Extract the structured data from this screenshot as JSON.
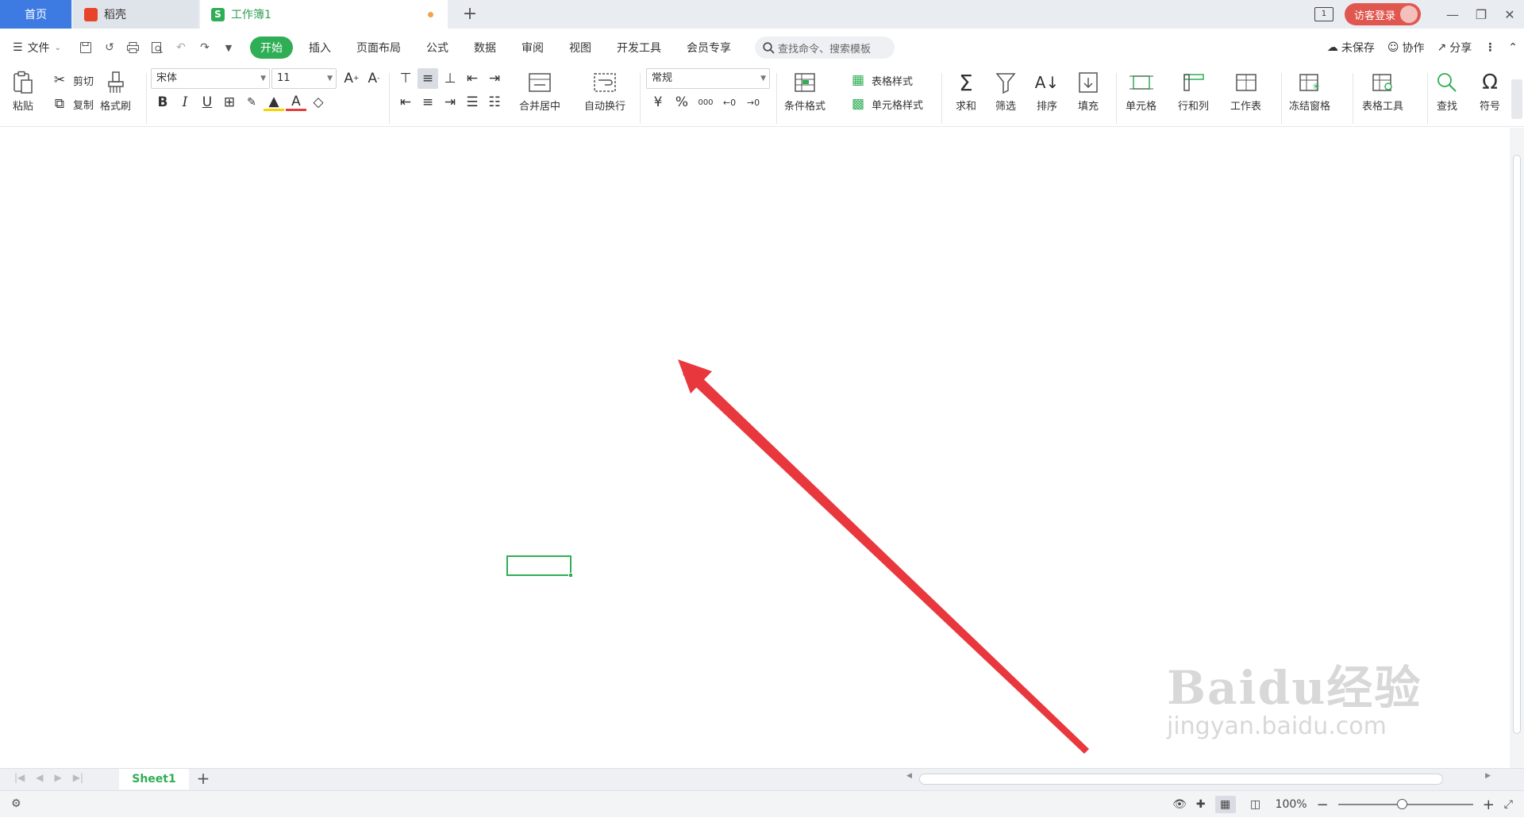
{
  "tabs": {
    "home": "首页",
    "daoke": "稻壳",
    "doc": "工作簿1",
    "doc_icon_letter": "S"
  },
  "window": {
    "screen_badge": "1",
    "login_label": "访客登录"
  },
  "menubar": {
    "file_label": "文件",
    "tabs": [
      "开始",
      "插入",
      "页面布局",
      "公式",
      "数据",
      "审阅",
      "视图",
      "开发工具",
      "会员专享"
    ],
    "active_tab": "开始",
    "search_placeholder": "查找命令、搜索模板",
    "unsaved_label": "未保存",
    "collab_label": "协作",
    "share_label": "分享"
  },
  "ribbon": {
    "paste": "粘贴",
    "cut": "剪切",
    "copy": "复制",
    "format_painter": "格式刷",
    "font_name": "宋体",
    "font_size": "11",
    "merge_center": "合并居中",
    "wrap_text": "自动换行",
    "number_format": "常规",
    "currency_symbol": "¥",
    "percent_symbol": "%",
    "thousands_symbol": "000",
    "conditional_format": "条件格式",
    "table_style": "表格样式",
    "cell_style": "单元格样式",
    "sum": "求和",
    "filter": "筛选",
    "sort": "排序",
    "fill": "填充",
    "cell": "单元格",
    "row_col": "行和列",
    "worksheet": "工作表",
    "freeze": "冻结窗格",
    "table_tools": "表格工具",
    "find": "查找",
    "symbol": "符号"
  },
  "sheet": {
    "tab_name": "Sheet1"
  },
  "status": {
    "zoom": "100%",
    "zoom_level": 1.0
  },
  "watermark": {
    "logo": "Baidu经验",
    "url": "jingyan.baidu.com"
  },
  "colors": {
    "accent_green": "#2fae55",
    "home_tab_blue": "#3d7be3",
    "login_red": "#e0574f",
    "arrow_red": "#e8383d"
  }
}
